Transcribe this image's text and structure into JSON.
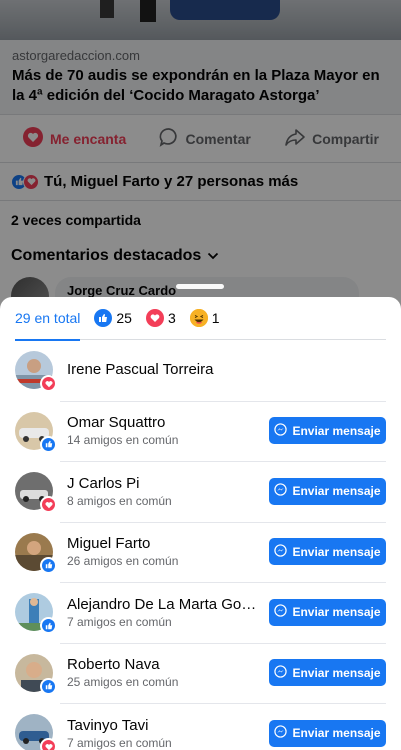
{
  "post": {
    "link_domain": "astorgaredaccion.com",
    "link_title": "Más de 70 audis se expondrán en la Plaza Mayor en la 4ª edición del ‘Cocido Maragato Astorga’",
    "actions": {
      "love_label": "Me encanta",
      "comment_label": "Comentar",
      "share_label": "Compartir"
    },
    "reactions_summary": "Tú, Miguel Farto y 27 personas más",
    "shares_text": "2 veces compartida",
    "top_comments_label": "Comentarios destacados",
    "comment_author": "Jorge Cruz Cardo"
  },
  "reactions_sheet": {
    "tabs": [
      {
        "label": "29 en total",
        "icon": ""
      },
      {
        "label": "25",
        "icon": "like-icon"
      },
      {
        "label": "3",
        "icon": "love-icon"
      },
      {
        "label": "1",
        "icon": "haha-icon"
      }
    ],
    "message_button_label": "Enviar mensaje",
    "people": [
      {
        "name": "Irene Pascual Torreira",
        "mutual": "",
        "reaction": "love",
        "has_button": false
      },
      {
        "name": "Omar Squattro",
        "mutual": "14 amigos en común",
        "reaction": "like",
        "has_button": true
      },
      {
        "name": "J Carlos Pi",
        "mutual": "8 amigos en común",
        "reaction": "love",
        "has_button": true
      },
      {
        "name": "Miguel Farto",
        "mutual": "26 amigos en común",
        "reaction": "like",
        "has_button": true
      },
      {
        "name": "Alejandro De La Marta Gon...",
        "mutual": "7 amigos en común",
        "reaction": "like",
        "has_button": true
      },
      {
        "name": "Roberto Nava",
        "mutual": "25 amigos en común",
        "reaction": "like",
        "has_button": true
      },
      {
        "name": "Tavinyo Tavi",
        "mutual": "7 amigos en común",
        "reaction": "love",
        "has_button": true
      }
    ]
  },
  "colors": {
    "accent": "#1877f2",
    "love": "#f33e58",
    "haha": "#f7b125"
  }
}
